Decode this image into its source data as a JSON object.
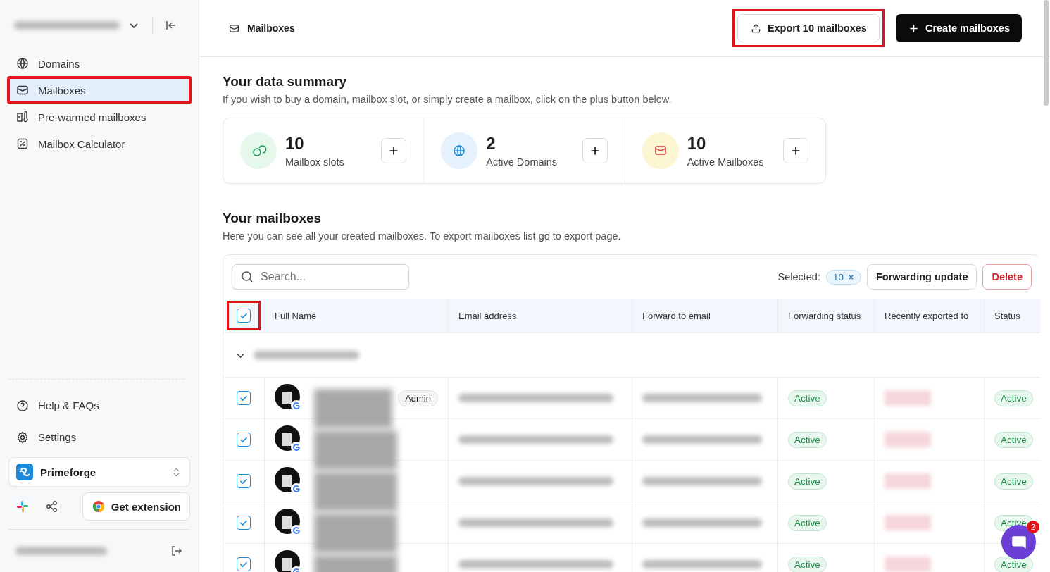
{
  "sidebar": {
    "items": [
      {
        "label": "Domains",
        "selected": false,
        "highlighted": false
      },
      {
        "label": "Mailboxes",
        "selected": true,
        "highlighted": true
      },
      {
        "label": "Pre-warmed mailboxes",
        "selected": false,
        "highlighted": false
      },
      {
        "label": "Mailbox Calculator",
        "selected": false,
        "highlighted": false
      }
    ],
    "footer_items": [
      {
        "label": "Help & FAQs"
      },
      {
        "label": "Settings"
      }
    ],
    "workspace": "Primeforge",
    "extension_button": "Get extension"
  },
  "header": {
    "breadcrumb": "Mailboxes",
    "export_button": {
      "label": "Export 10 mailboxes",
      "highlighted": true
    },
    "create_button": "Create mailboxes"
  },
  "summary": {
    "title": "Your data summary",
    "subtitle": "If you wish to buy a domain, mailbox slot, or simply create a mailbox, click on the plus button below.",
    "cards": [
      {
        "value": "10",
        "label": "Mailbox slots",
        "kind": "slots"
      },
      {
        "value": "2",
        "label": "Active Domains",
        "kind": "domains"
      },
      {
        "value": "10",
        "label": "Active Mailboxes",
        "kind": "mailboxes"
      }
    ]
  },
  "mailboxes": {
    "title": "Your mailboxes",
    "subtitle": "Here you can see all your created mailboxes. To export mailboxes list go to export page.",
    "search": {
      "placeholder": "Search..."
    },
    "selected_label": "Selected:",
    "selected_count": "10",
    "forwarding_button": "Forwarding update",
    "delete_button": "Delete",
    "header_checkbox": {
      "checked": true,
      "highlighted": true
    },
    "columns": [
      "Full Name",
      "Email address",
      "Forward to email",
      "Forwarding status",
      "Recently exported to",
      "Status"
    ],
    "rows": [
      {
        "checked": true,
        "badge": "Admin",
        "forwarding_status": "Active",
        "status": "Active"
      },
      {
        "checked": true,
        "forwarding_status": "Active",
        "status": "Active"
      },
      {
        "checked": true,
        "forwarding_status": "Active",
        "status": "Active"
      },
      {
        "checked": true,
        "forwarding_status": "Active",
        "status": "Active"
      },
      {
        "checked": true,
        "forwarding_status": "Active",
        "status": "Active"
      }
    ]
  },
  "chat": {
    "badge": "2"
  }
}
